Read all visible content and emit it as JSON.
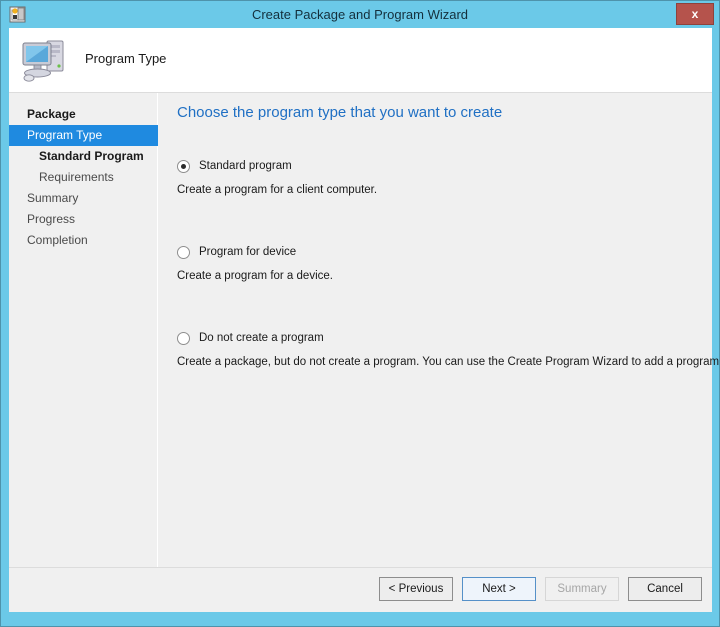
{
  "window": {
    "title": "Create Package and Program Wizard",
    "title_icon": "package-wizard-icon",
    "close_label": "x",
    "accent_color": "#6bc9e8",
    "close_color": "#b5534c"
  },
  "header": {
    "title": "Program Type",
    "icon": "computer-icon"
  },
  "sidebar": {
    "items": [
      {
        "label": "Package",
        "state": "completed",
        "level": 0
      },
      {
        "label": "Program Type",
        "state": "active",
        "level": 0
      },
      {
        "label": "Standard Program",
        "state": "completed",
        "level": 1
      },
      {
        "label": "Requirements",
        "state": "pending",
        "level": 1
      },
      {
        "label": "Summary",
        "state": "pending",
        "level": 0
      },
      {
        "label": "Progress",
        "state": "pending",
        "level": 0
      },
      {
        "label": "Completion",
        "state": "pending",
        "level": 0
      }
    ],
    "active_color": "#1f8ae0"
  },
  "content": {
    "heading": "Choose the program type that you want to create",
    "heading_color": "#2070c4",
    "options": [
      {
        "label": "Standard program",
        "description": "Create a program for a client computer.",
        "selected": true
      },
      {
        "label": "Program for device",
        "description": "Create a program for a device.",
        "selected": false
      },
      {
        "label": "Do not create a program",
        "description": "Create a package, but do not create a program. You can use the Create Program Wizard to add a program later.",
        "selected": false
      }
    ]
  },
  "footer": {
    "buttons": [
      {
        "label": "< Previous",
        "style": "normal"
      },
      {
        "label": "Next >",
        "style": "default"
      },
      {
        "label": "Summary",
        "style": "disabled"
      },
      {
        "label": "Cancel",
        "style": "normal"
      }
    ]
  }
}
